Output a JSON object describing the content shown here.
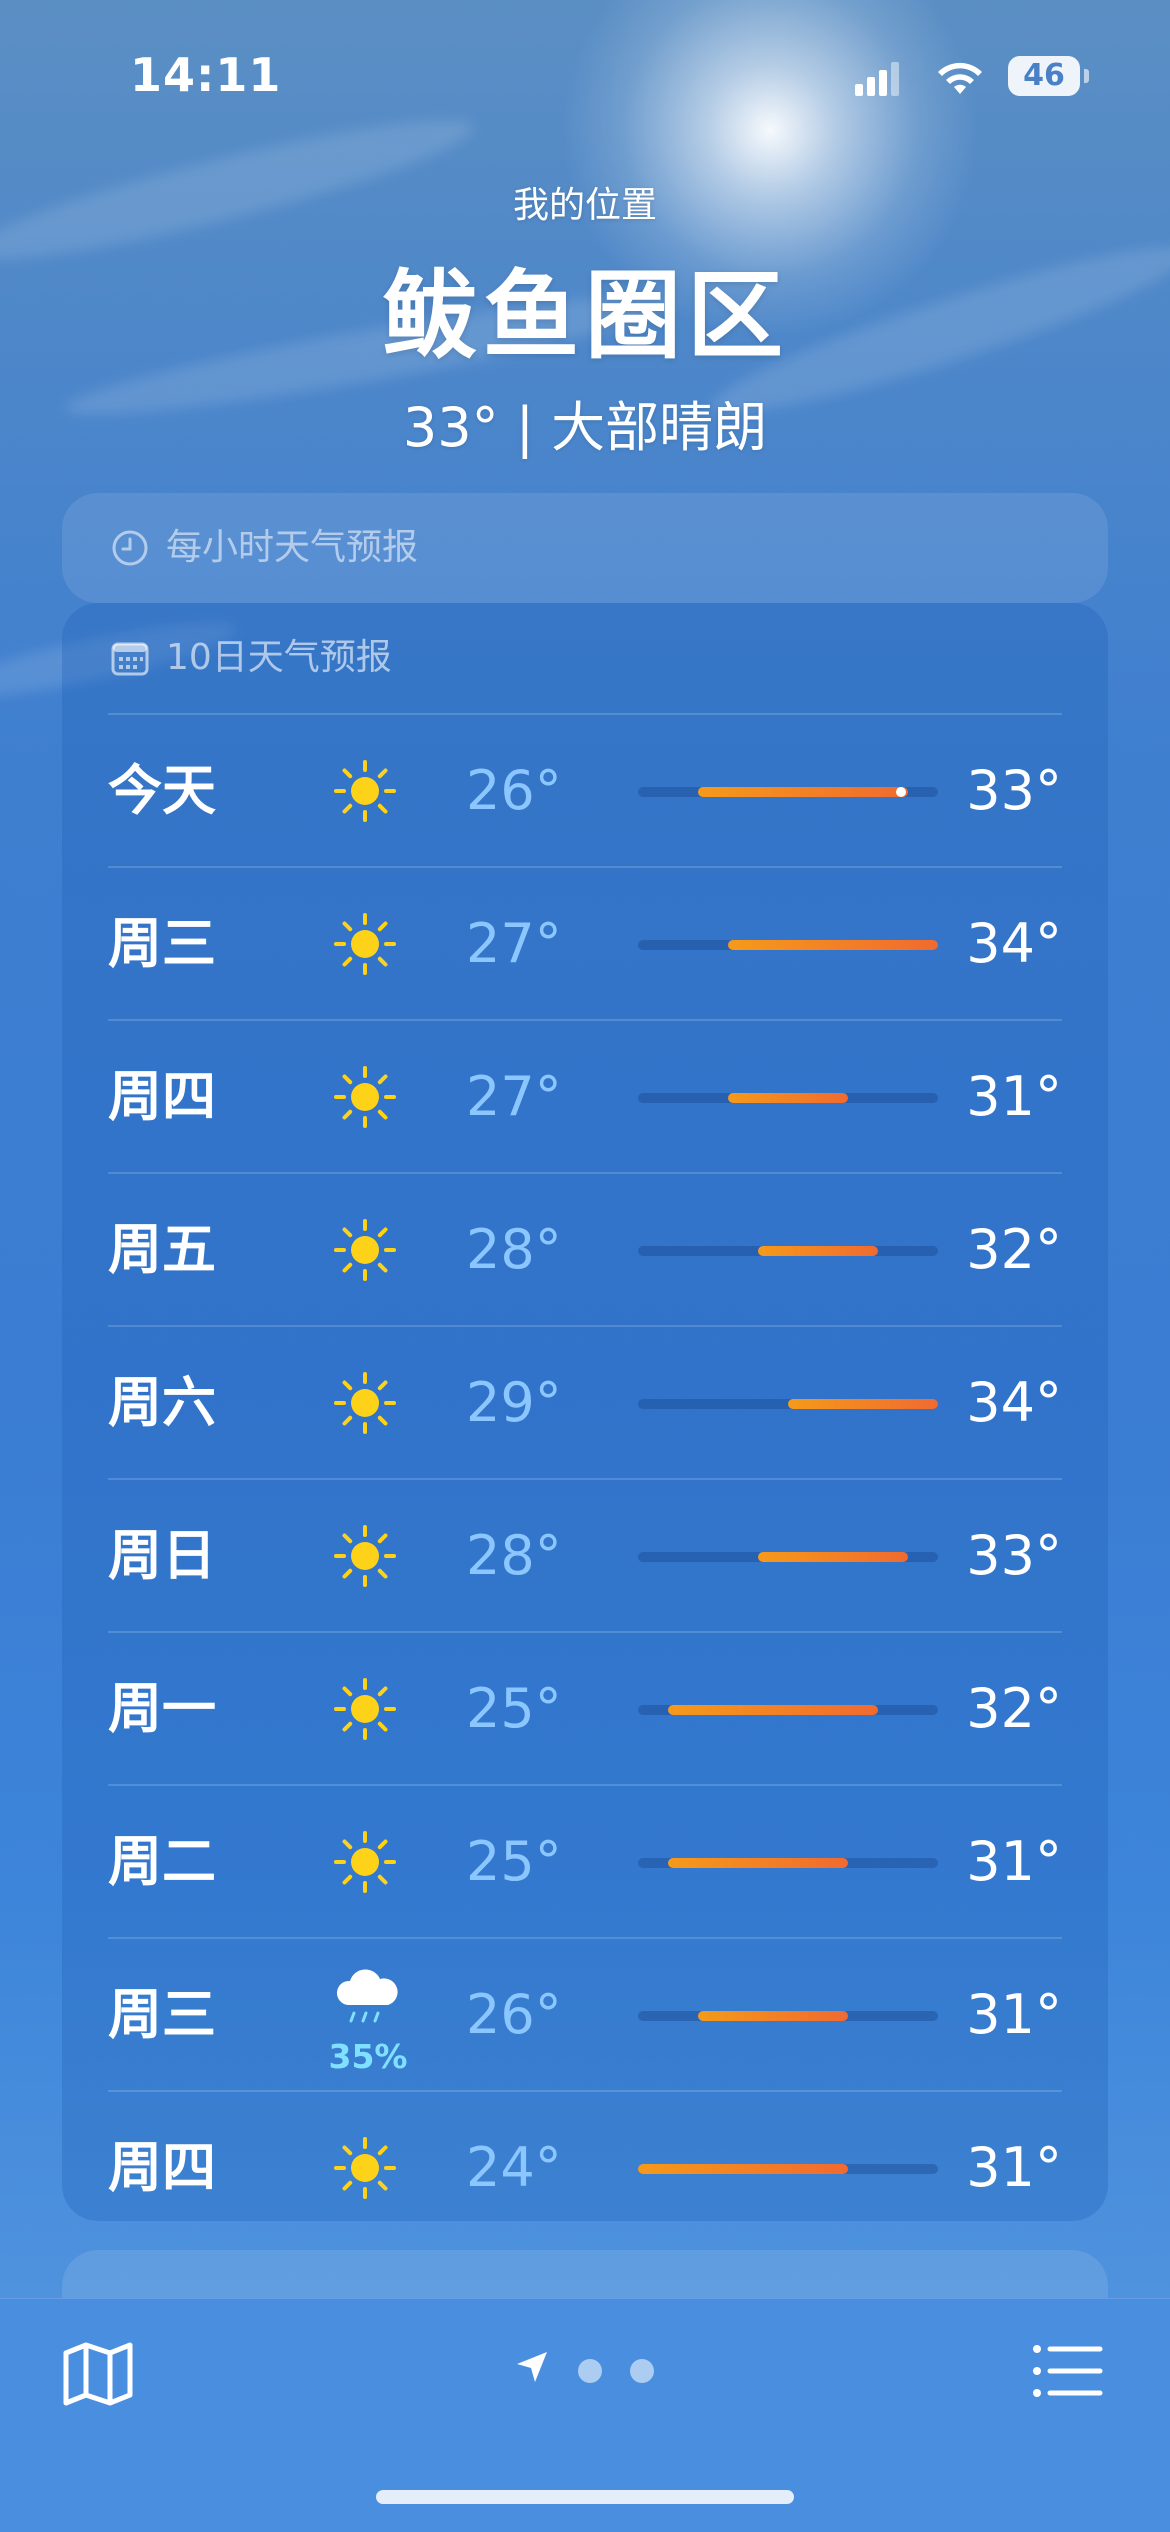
{
  "status_bar": {
    "time": "14:11",
    "battery": "46"
  },
  "header": {
    "my_location": "我的位置",
    "city": "鲅鱼圈区",
    "current": "33° | 大部晴朗"
  },
  "hourly": {
    "title": "每小时天气预报",
    "icon": "clock-icon"
  },
  "forecast": {
    "title": "10日天气预报",
    "icon": "calendar-icon",
    "range_min": 24,
    "range_max": 34,
    "days": [
      {
        "day": "今天",
        "icon": "sun-icon",
        "low": "26°",
        "high": "33°",
        "low_v": 26,
        "high_v": 33,
        "current_v": 33
      },
      {
        "day": "周三",
        "icon": "sun-icon",
        "low": "27°",
        "high": "34°",
        "low_v": 27,
        "high_v": 34
      },
      {
        "day": "周四",
        "icon": "sun-icon",
        "low": "27°",
        "high": "31°",
        "low_v": 27,
        "high_v": 31
      },
      {
        "day": "周五",
        "icon": "sun-icon",
        "low": "28°",
        "high": "32°",
        "low_v": 28,
        "high_v": 32
      },
      {
        "day": "周六",
        "icon": "sun-icon",
        "low": "29°",
        "high": "34°",
        "low_v": 29,
        "high_v": 34
      },
      {
        "day": "周日",
        "icon": "sun-icon",
        "low": "28°",
        "high": "33°",
        "low_v": 28,
        "high_v": 33
      },
      {
        "day": "周一",
        "icon": "sun-icon",
        "low": "25°",
        "high": "32°",
        "low_v": 25,
        "high_v": 32
      },
      {
        "day": "周二",
        "icon": "sun-icon",
        "low": "25°",
        "high": "31°",
        "low_v": 25,
        "high_v": 31
      },
      {
        "day": "周三",
        "icon": "rain-cloud-icon",
        "precip": "35%",
        "low": "26°",
        "high": "31°",
        "low_v": 26,
        "high_v": 31
      },
      {
        "day": "周四",
        "icon": "sun-icon",
        "low": "24°",
        "high": "31°",
        "low_v": 24,
        "high_v": 31
      }
    ]
  },
  "colors": {
    "bar_cool": "#f59a1a",
    "bar_hot": "#f06a30",
    "sun": "#ffd21a",
    "low_temp": "#8cc6ff",
    "precip": "#7fe0ff"
  },
  "toolbar": {
    "map": "map-icon",
    "location": "location-arrow-icon",
    "pages": 3,
    "list": "list-icon"
  }
}
